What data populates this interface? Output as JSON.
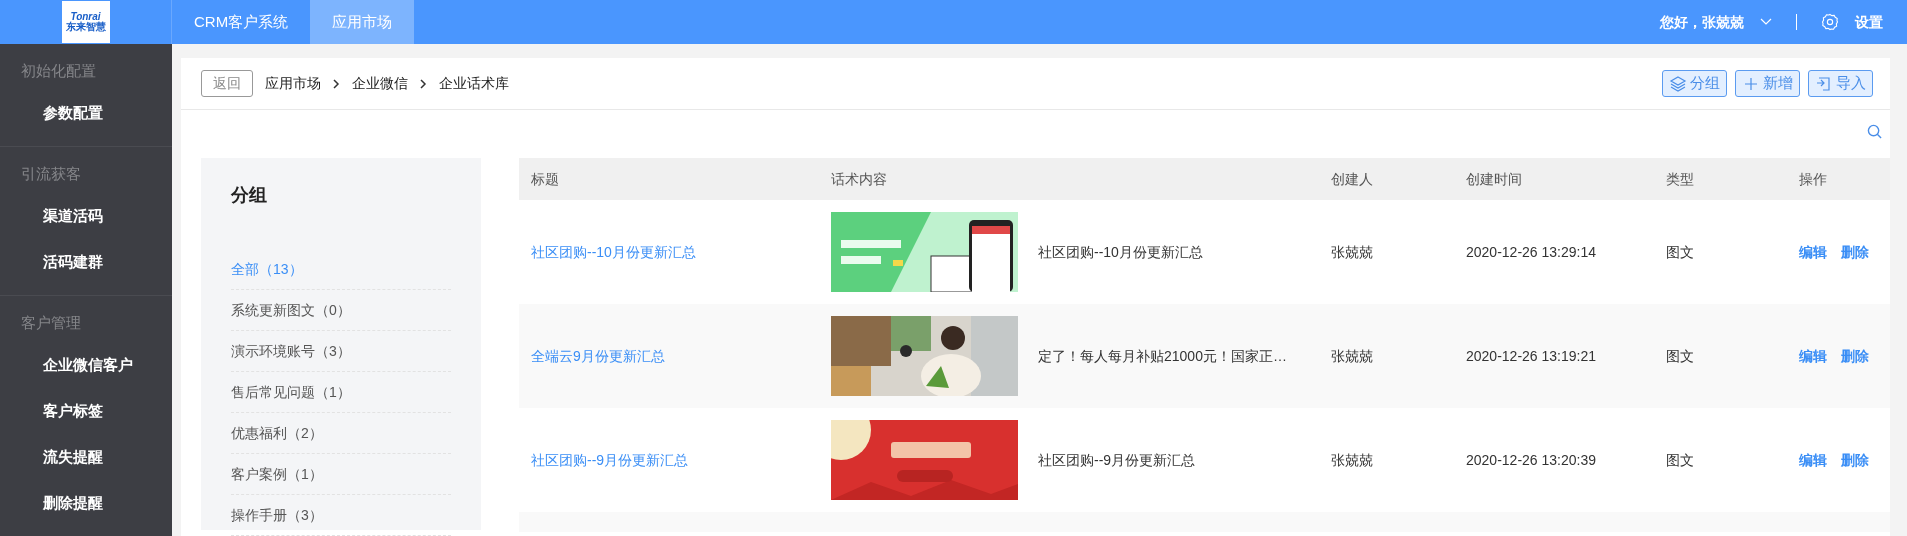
{
  "header": {
    "logo": {
      "line1": "Tonrai",
      "line2": "东来智慧"
    },
    "nav_tabs": [
      {
        "label": "CRM客户系统",
        "selected": false
      },
      {
        "label": "应用市场",
        "selected": true
      }
    ],
    "greeting": "您好，张兢兢",
    "settings": "设置"
  },
  "sidebar": {
    "sections": [
      {
        "title": "初始化配置",
        "items": [
          {
            "label": "参数配置"
          }
        ]
      },
      {
        "title": "引流获客",
        "items": [
          {
            "label": "渠道活码"
          },
          {
            "label": "活码建群"
          }
        ]
      },
      {
        "title": "客户管理",
        "items": [
          {
            "label": "企业微信客户"
          },
          {
            "label": "客户标签"
          },
          {
            "label": "流失提醒"
          },
          {
            "label": "删除提醒"
          }
        ]
      }
    ]
  },
  "toolbar": {
    "back": "返回",
    "breadcrumb": [
      "应用市场",
      "企业微信",
      "企业话术库"
    ],
    "buttons": [
      {
        "kind": "layers",
        "label": "分组"
      },
      {
        "kind": "plus",
        "label": "新增"
      },
      {
        "kind": "import",
        "label": "导入"
      }
    ]
  },
  "groups": {
    "title": "分组",
    "items": [
      {
        "label": "全部（13）",
        "selected": true
      },
      {
        "label": "系统更新图文（0）",
        "selected": false
      },
      {
        "label": "演示环境账号（3）",
        "selected": false
      },
      {
        "label": "售后常见问题（1）",
        "selected": false
      },
      {
        "label": "优惠福利（2）",
        "selected": false
      },
      {
        "label": "客户案例（1）",
        "selected": false
      },
      {
        "label": "操作手册（3）",
        "selected": false
      }
    ]
  },
  "table": {
    "columns": [
      "标题",
      "话术内容",
      "创建人",
      "创建时间",
      "类型",
      "操作"
    ],
    "rows": [
      {
        "title": "社区团购--10月份更新汇总",
        "picture": {
          "kind": "picture"
        },
        "content": "社区团购--10月份更新汇总",
        "creator": "张兢兢",
        "created": "2020-12-26 13:29:14",
        "type": "图文",
        "actions": [
          "编辑",
          "删除"
        ]
      },
      {
        "title": "全端云9月份更新汇总",
        "picture": {
          "kind": "picture"
        },
        "content": "定了！每人每月补贴21000元！国家正…",
        "creator": "张兢兢",
        "created": "2020-12-26 13:19:21",
        "type": "图文",
        "actions": [
          "编辑",
          "删除"
        ]
      },
      {
        "title": "社区团购--9月份更新汇总",
        "picture": {
          "kind": "picture"
        },
        "content": "社区团购--9月份更新汇总",
        "creator": "张兢兢",
        "created": "2020-12-26 13:20:39",
        "type": "图文",
        "actions": [
          "编辑",
          "删除"
        ]
      }
    ]
  }
}
